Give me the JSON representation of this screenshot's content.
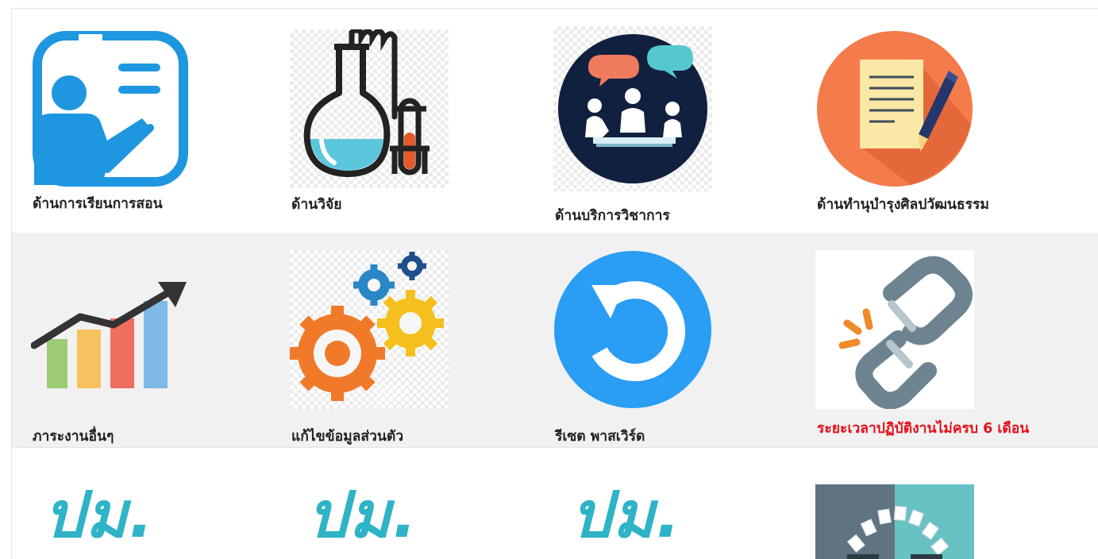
{
  "menu": {
    "row1": [
      {
        "label": "ด้านการเรียนการสอน",
        "icon": "teacher-presentation-icon"
      },
      {
        "label": "ด้านวิจัย",
        "icon": "laboratory-flask-icon"
      },
      {
        "label": "ด้านบริการวิชาการ",
        "icon": "meeting-discussion-icon"
      },
      {
        "label": "ด้านทำนุบำรุงศิลปวัฒนธรรม",
        "icon": "document-pen-icon"
      }
    ],
    "row2": [
      {
        "label": "ภาระงานอื่นๆ",
        "icon": "growth-chart-icon"
      },
      {
        "label": "แก้ไขข้อมูลส่วนตัว",
        "icon": "gears-icon"
      },
      {
        "label": "รีเซต พาสเวิร์ด",
        "icon": "reset-arrow-icon"
      },
      {
        "label": "ระยะเวลาปฏิบัติงานไม่ครบ 6 เดือน",
        "icon": "broken-chain-icon"
      }
    ],
    "row3": [
      {
        "label": "ปม.",
        "icon": "pm-logo"
      },
      {
        "label": "ปม.",
        "icon": "pm-logo"
      },
      {
        "label": "ปม.",
        "icon": "pm-logo"
      },
      {
        "label": "",
        "icon": "document-arc-icon"
      }
    ]
  },
  "colors": {
    "label_default": "#222222",
    "label_warning": "#e3101a",
    "pm_teal": "#2fb3c6",
    "row_alt_bg": "#f1f1f1"
  }
}
